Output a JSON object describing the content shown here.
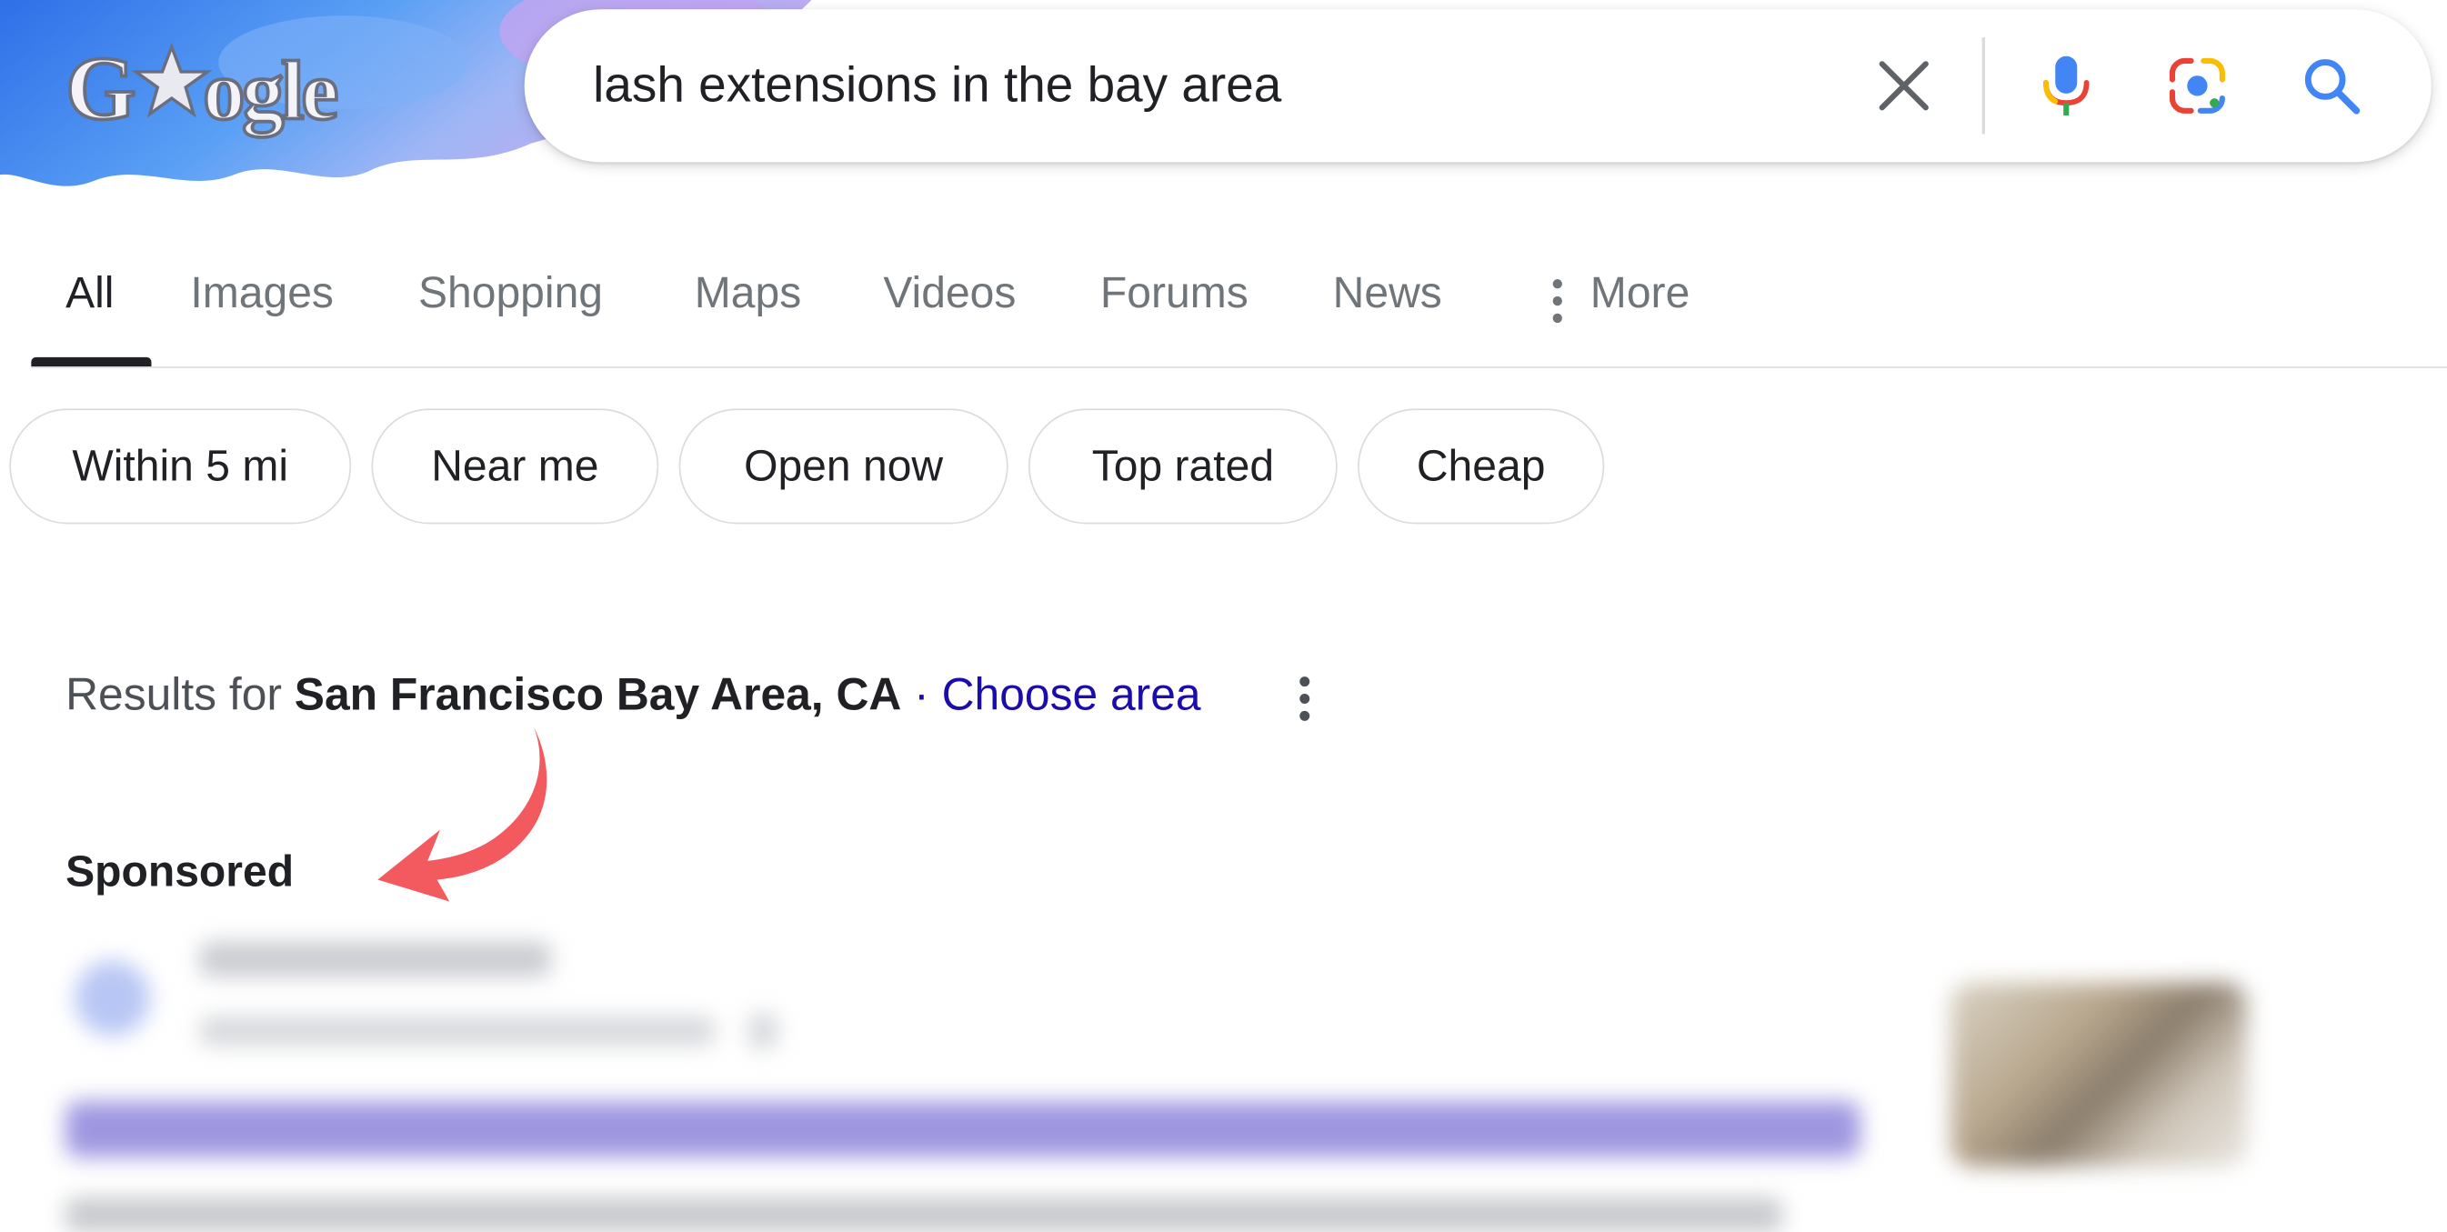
{
  "logo": {
    "text": "Google",
    "alt": "Google doodle logo"
  },
  "search": {
    "query": "lash extensions in the bay area",
    "clear_icon": "close-icon",
    "mic_icon": "microphone-icon",
    "lens_icon": "google-lens-icon",
    "search_icon": "search-icon"
  },
  "tabs": [
    {
      "label": "All",
      "active": true
    },
    {
      "label": "Images"
    },
    {
      "label": "Shopping"
    },
    {
      "label": "Maps"
    },
    {
      "label": "Videos"
    },
    {
      "label": "Forums"
    },
    {
      "label": "News"
    },
    {
      "label": "More",
      "icon": "more-vertical-icon"
    }
  ],
  "chips": [
    "Within 5 mi",
    "Near me",
    "Open now",
    "Top rated",
    "Cheap"
  ],
  "results_for": {
    "prefix": "Results for",
    "location": "San Francisco Bay Area, CA",
    "separator": "·",
    "choose_area": "Choose area"
  },
  "sponsored_label": "Sponsored",
  "colors": {
    "link": "#1a0dab",
    "annotation_arrow": "#f25a5f",
    "doodle_blue": "#4f8ef2",
    "doodle_purple": "#b49cf0"
  }
}
